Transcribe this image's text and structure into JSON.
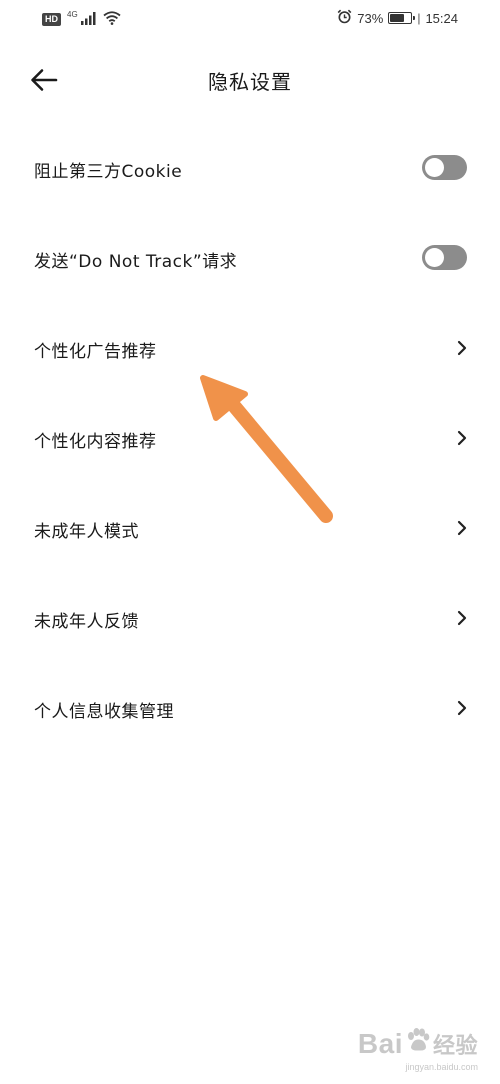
{
  "status_bar": {
    "hd_badge": "HD",
    "network": "4G",
    "alarm_icon": "alarm-icon",
    "battery_percent": "73%",
    "battery_level": 0.73,
    "time": "15:24"
  },
  "header": {
    "back_icon": "arrow-left-icon",
    "title": "隐私设置"
  },
  "settings": {
    "items": [
      {
        "label": "阻止第三方Cookie",
        "control": "toggle",
        "on": false
      },
      {
        "label": "发送“Do Not Track”请求",
        "control": "toggle",
        "on": false
      },
      {
        "label": "个性化广告推荐",
        "control": "chevron"
      },
      {
        "label": "个性化内容推荐",
        "control": "chevron"
      },
      {
        "label": "未成年人模式",
        "control": "chevron"
      },
      {
        "label": "未成年人反馈",
        "control": "chevron"
      },
      {
        "label": "个人信息收集管理",
        "control": "chevron"
      }
    ]
  },
  "annotation": {
    "arrow_color": "#f0924a",
    "points_to": "个性化广告推荐"
  },
  "watermark": {
    "brand_left": "Bai",
    "brand_right": "经验",
    "url": "jingyan.baidu.com"
  },
  "colors": {
    "background": "#ffffff",
    "text": "#1a1a1a",
    "toggle_off": "#8c8c8c",
    "toggle_knob": "#ffffff",
    "chevron": "#222222"
  }
}
